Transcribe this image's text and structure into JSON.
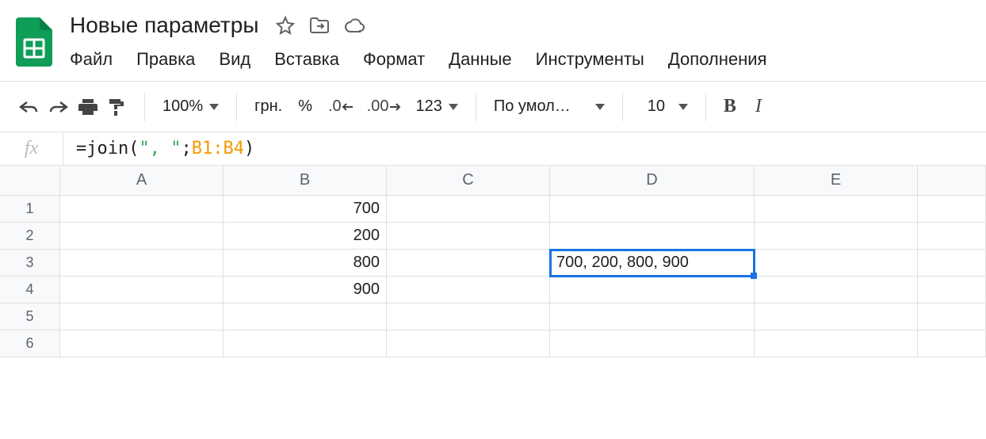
{
  "doc": {
    "title": "Новые параметры"
  },
  "menu": {
    "file": "Файл",
    "edit": "Правка",
    "view": "Вид",
    "insert": "Вставка",
    "format": "Формат",
    "data": "Данные",
    "tools": "Инструменты",
    "addons": "Дополнения"
  },
  "toolbar": {
    "zoom": "100%",
    "currency": "грн.",
    "percent": "%",
    "dec_remove": ".0",
    "dec_add": ".00",
    "more_formats": "123",
    "font": "По умол…",
    "font_size": "10",
    "bold": "B",
    "italic": "I"
  },
  "fx": {
    "label": "fx",
    "eq": "=",
    "fn": "join",
    "open": "(",
    "str": "\", \"",
    "sep": ";",
    "ref": "B1:B4",
    "close": ")"
  },
  "columns": [
    "A",
    "B",
    "C",
    "D",
    "E",
    ""
  ],
  "rows": [
    "1",
    "2",
    "3",
    "4",
    "5",
    "6"
  ],
  "cells": {
    "B1": "700",
    "B2": "200",
    "B3": "800",
    "B4": "900",
    "D3": "700, 200, 800, 900"
  },
  "active_cell": "D3"
}
